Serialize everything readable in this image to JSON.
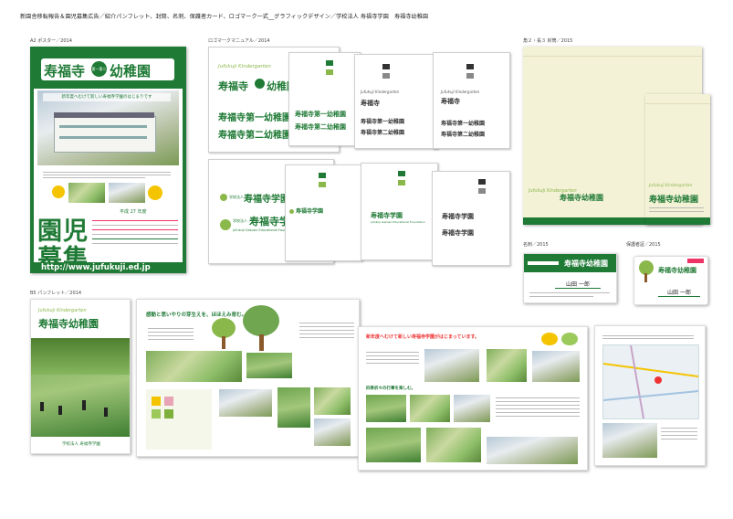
{
  "header": {
    "title": "新園舎移転報告＆園児募集広告／紹介パンフレット、封筒、名刺、保護者カード、ロゴマーク一式__グラフィックデザイン／学校法人 寿福寺学園　寿福寺幼稚園"
  },
  "labels": {
    "poster": "A2 ポスター／2014",
    "logo_manual": "ロゴマークマニュアル／2014",
    "envelope": "角２・長３ 封筒／2015",
    "card": "名刺／2015",
    "guardian_card": "保護者証／2015",
    "pamphlet": "B5 パンフレット／2014"
  },
  "poster": {
    "title_left": "寿福寺",
    "title_badge": "第一第二",
    "title_right": "幼稚園",
    "banner": "新年度へむけて新しい寿福寺学園のはじまりです",
    "year": "平成 27 年度",
    "big1": "園児",
    "big2": "募集",
    "url": "http://www.jufukuji.ed.jp"
  },
  "logo_manual": {
    "kg_text": "Jufukuji Kindergarten",
    "name_main": "寿福寺",
    "name_tail": "幼稚園",
    "first": "寿福寺第一幼稚園",
    "second": "寿福寺第二幼稚園",
    "gakuen_prefix": "学校法人",
    "gakuen": "寿福寺学園",
    "foundation": "Jufukuji Gakuen Educational Foundation"
  },
  "envelope": {
    "kg_text": "Jufukuji Kindergarten",
    "name": "寿福寺幼稚園"
  },
  "card": {
    "name": "山田 一郎",
    "org": "寿福寺幼稚園"
  },
  "guardian_card": {
    "name": "山田 一郎"
  },
  "pamphlet": {
    "kg_text": "Jufukuji Kindergarten",
    "cover_name": "寿福寺幼稚園",
    "footer": "学校法人 寿福寺学園",
    "spread1_heading": "感動と思いやりの芽生えを、ほほえみ育む。",
    "spread2_heading": "新年度へむけて新しい寿福寺学園がはじまっています。",
    "spread2_sub": "四季折々の行事を楽しむ。"
  },
  "colors": {
    "brand_green": "#1f7a35",
    "leaf_green": "#8ab84a",
    "envelope_cream": "#f3f1d6"
  }
}
